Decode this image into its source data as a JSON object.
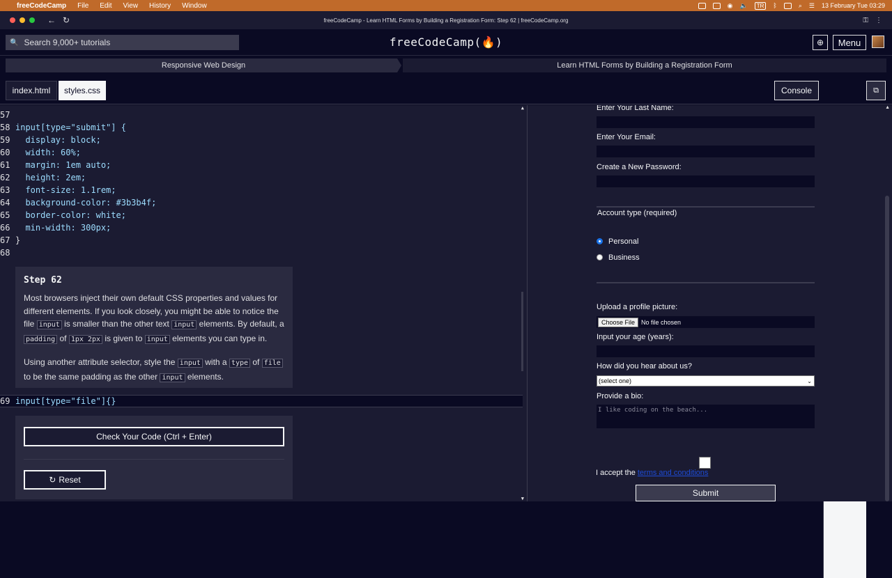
{
  "os_menubar": {
    "app_name": "freeCodeCamp",
    "items": [
      "File",
      "Edit",
      "View",
      "History",
      "Window"
    ],
    "input_source": "TR",
    "clock": "13 February Tue  03:29"
  },
  "window": {
    "title": "freeCodeCamp - Learn HTML Forms by Building a Registration Form: Step 62 | freeCodeCamp.org"
  },
  "header": {
    "search_placeholder": "Search 9,000+ tutorials",
    "logo": "freeCodeCamp(🔥)",
    "menu_label": "Menu"
  },
  "breadcrumb": {
    "superblock": "Responsive Web Design",
    "block": "Learn HTML Forms by Building a Registration Form"
  },
  "tabs": {
    "index": "index.html",
    "styles": "styles.css",
    "console": "Console",
    "preview": "Preview"
  },
  "code": {
    "lines": [
      {
        "n": "57",
        "text": ""
      },
      {
        "n": "58",
        "text": "input[type=\"submit\"] {"
      },
      {
        "n": "59",
        "text": "  display: block;"
      },
      {
        "n": "60",
        "text": "  width: 60%;"
      },
      {
        "n": "61",
        "text": "  margin: 1em auto;"
      },
      {
        "n": "62",
        "text": "  height: 2em;"
      },
      {
        "n": "63",
        "text": "  font-size: 1.1rem;"
      },
      {
        "n": "64",
        "text": "  background-color: #3b3b4f;"
      },
      {
        "n": "65",
        "text": "  border-color: white;"
      },
      {
        "n": "66",
        "text": "  min-width: 300px;"
      },
      {
        "n": "67",
        "text": "}"
      },
      {
        "n": "68",
        "text": ""
      }
    ],
    "active_line_number": "69",
    "active_line_text": "input[type=\"file\"]{}"
  },
  "step": {
    "title": "Step 62",
    "p1_a": "Most browsers inject their own default CSS properties and values for different elements. If you look closely, you might be able to notice the file ",
    "p1_code1": "input",
    "p1_b": " is smaller than the other text ",
    "p1_code2": "input",
    "p1_c": " elements. By default, a ",
    "p1_code3": "padding",
    "p1_d": " of ",
    "p1_code4": "1px 2px",
    "p1_e": " is given to ",
    "p1_code5": "input",
    "p1_f": " elements you can type in.",
    "p2_a": "Using another attribute selector, style the ",
    "p2_code1": "input",
    "p2_b": " with a ",
    "p2_code2": "type",
    "p2_c": " of ",
    "p2_code3": "file",
    "p2_d": " to be the same padding as the other ",
    "p2_code4": "input",
    "p2_e": " elements."
  },
  "actions": {
    "check": "Check Your Code (Ctrl + Enter)",
    "reset": "Reset"
  },
  "preview": {
    "last_name_label": "Enter Your Last Name:",
    "email_label": "Enter Your Email:",
    "password_label": "Create a New Password:",
    "account_type_label": "Account type (required)",
    "personal_label": "Personal",
    "business_label": "Business",
    "upload_label": "Upload a profile picture:",
    "choose_file": "Choose File",
    "no_file": "No file chosen",
    "age_label": "Input your age (years):",
    "hear_label": "How did you hear about us?",
    "select_value": "(select one)",
    "bio_label": "Provide a bio:",
    "bio_placeholder": "I like coding on the beach...",
    "accept_text": "I accept the",
    "terms_link": "terms and conditions",
    "submit": "Submit"
  },
  "colors": {
    "bg": "#0a0a23",
    "panel": "#1b1b32",
    "accent": "#3b3b4f",
    "menubar": "#c06a2a"
  }
}
